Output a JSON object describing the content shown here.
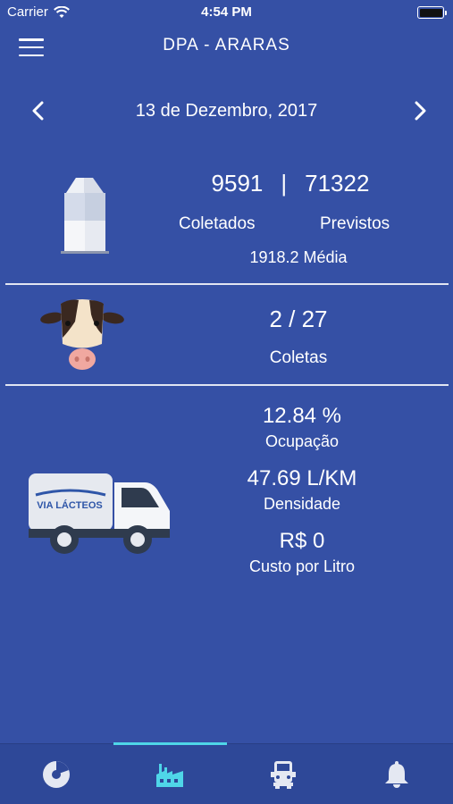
{
  "status_bar": {
    "carrier": "Carrier",
    "time": "4:54 PM"
  },
  "header": {
    "title": "DPA - ARARAS",
    "menu_icon": "hamburger-menu-icon"
  },
  "date_nav": {
    "date": "13 de Dezembro, 2017",
    "prev_icon": "chevron-left-icon",
    "next_icon": "chevron-right-icon"
  },
  "milk": {
    "collected": "9591",
    "separator": "|",
    "forecast": "71322",
    "collected_label": "Coletados",
    "forecast_label": "Previstos",
    "average": "1918.2 Média",
    "icon": "milk-carton-icon"
  },
  "collections": {
    "value": "2 / 27",
    "label": "Coletas",
    "icon": "cow-icon"
  },
  "truck": {
    "occupancy": "12.84 %",
    "occupancy_label": "Ocupação",
    "density": "47.69 L/KM",
    "density_label": "Densidade",
    "cost": "R$ 0",
    "cost_label": "Custo por Litro",
    "brand": "VIA LÁCTEOS",
    "icon": "truck-icon"
  },
  "tabs": [
    {
      "icon": "pie-chart-icon",
      "active": false
    },
    {
      "icon": "factory-icon",
      "active": true
    },
    {
      "icon": "truck-tab-icon",
      "active": false
    },
    {
      "icon": "bell-icon",
      "active": false
    }
  ],
  "colors": {
    "background": "#3550A5",
    "tab_bar": "#2E4898",
    "accent": "#4FD6E8"
  }
}
